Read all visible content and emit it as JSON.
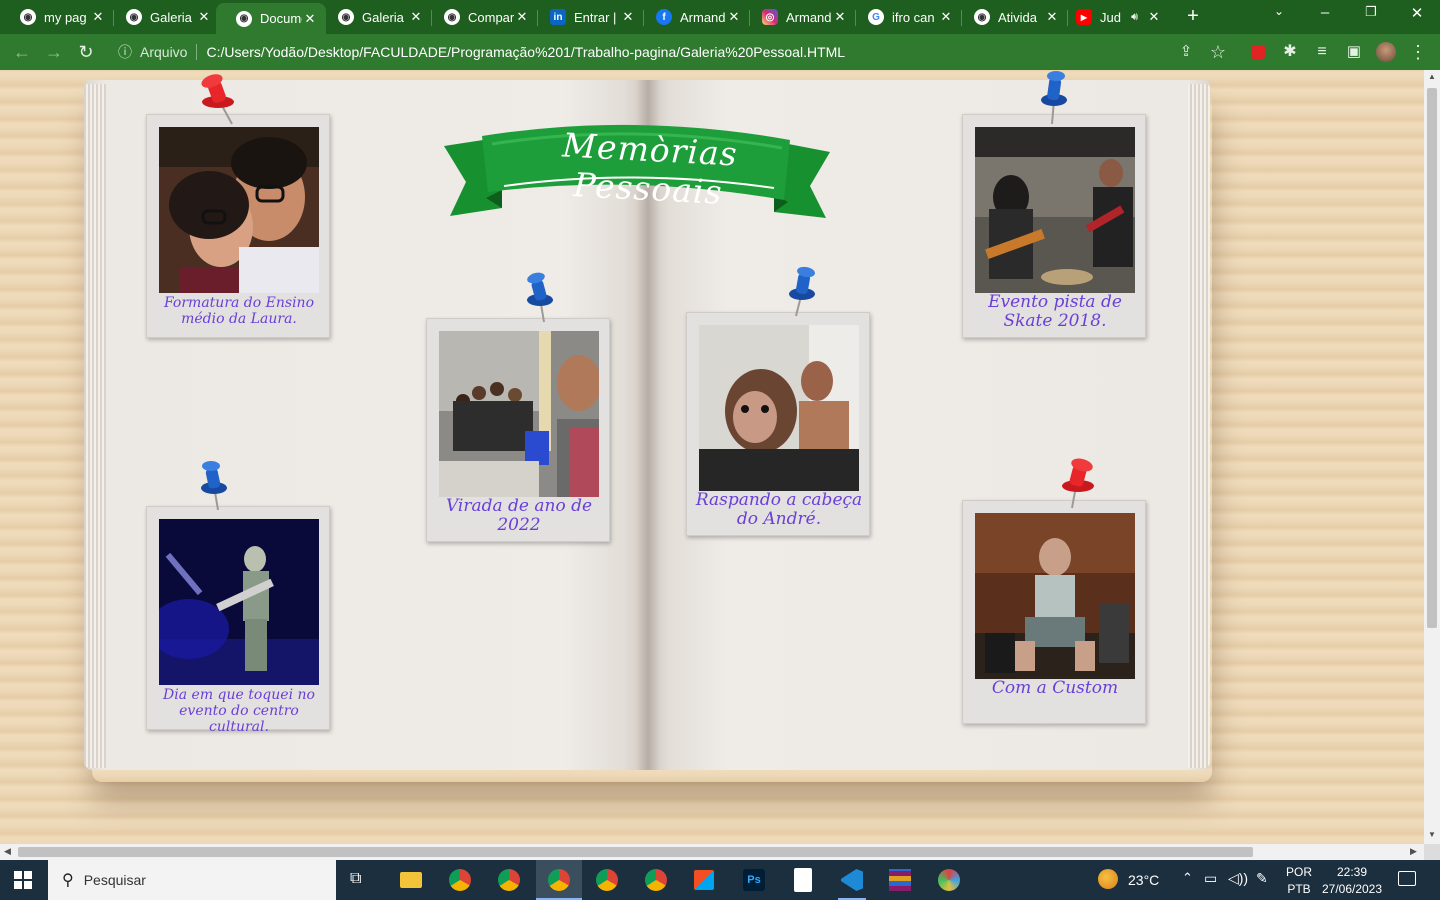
{
  "browser": {
    "tabs": [
      {
        "title": "my pag",
        "icon": "globe-icon",
        "color": "#ffffff",
        "active": false
      },
      {
        "title": "Galeria",
        "icon": "globe-icon",
        "color": "#ffffff",
        "active": false
      },
      {
        "title": "Docume",
        "icon": "globe-icon",
        "color": "#ffffff",
        "active": true
      },
      {
        "title": "Galeria",
        "icon": "globe-icon",
        "color": "#ffffff",
        "active": false
      },
      {
        "title": "Compar",
        "icon": "globe-icon",
        "color": "#ffffff",
        "active": false
      },
      {
        "title": "Entrar |",
        "icon": "linkedin-icon",
        "color": "#0a66c2",
        "active": false
      },
      {
        "title": "Armand",
        "icon": "facebook-icon",
        "color": "#1877f2",
        "active": false
      },
      {
        "title": "Armand",
        "icon": "instagram-icon",
        "color": "#d62976",
        "active": false
      },
      {
        "title": "ifro can",
        "icon": "google-icon",
        "color": "#ffffff",
        "active": false
      },
      {
        "title": "Ativida",
        "icon": "globe-icon",
        "color": "#ffffff",
        "active": false
      },
      {
        "title": "Jud",
        "icon": "youtube-icon",
        "color": "#ff0000",
        "active": false
      }
    ],
    "new_tab": "+",
    "close_glyph": "✕",
    "address": {
      "scheme_label": "Arquivo",
      "url": "C:/Users/Yodão/Desktop/FACULDADE/Programação%201/Trabalho-pagina/Galeria%20Pessoal.HTML"
    }
  },
  "page": {
    "banner_title": "Memòrias Pessoais",
    "colors": {
      "banner": "#1e9e3a",
      "banner_dark": "#137a2a",
      "caption": "#6a3fd8",
      "pin_red": "#e8262a",
      "pin_blue": "#1f63c8"
    },
    "photos": [
      {
        "caption": "Formatura do Ensino médio da Laura.",
        "pin": "red"
      },
      {
        "caption": "Virada de ano de 2022",
        "pin": "blue"
      },
      {
        "caption": "Raspando a cabeça do André.",
        "pin": "blue"
      },
      {
        "caption": "Evento pista de Skate 2018.",
        "pin": "blue"
      },
      {
        "caption": "Dia em que toquei no evento do centro cultural.",
        "pin": "blue"
      },
      {
        "caption": "Com a Custom",
        "pin": "red"
      }
    ]
  },
  "taskbar": {
    "search_placeholder": "Pesquisar",
    "weather": "23°C",
    "lang_top": "POR",
    "lang_bottom": "PTB",
    "time": "22:39",
    "date": "27/06/2023"
  }
}
